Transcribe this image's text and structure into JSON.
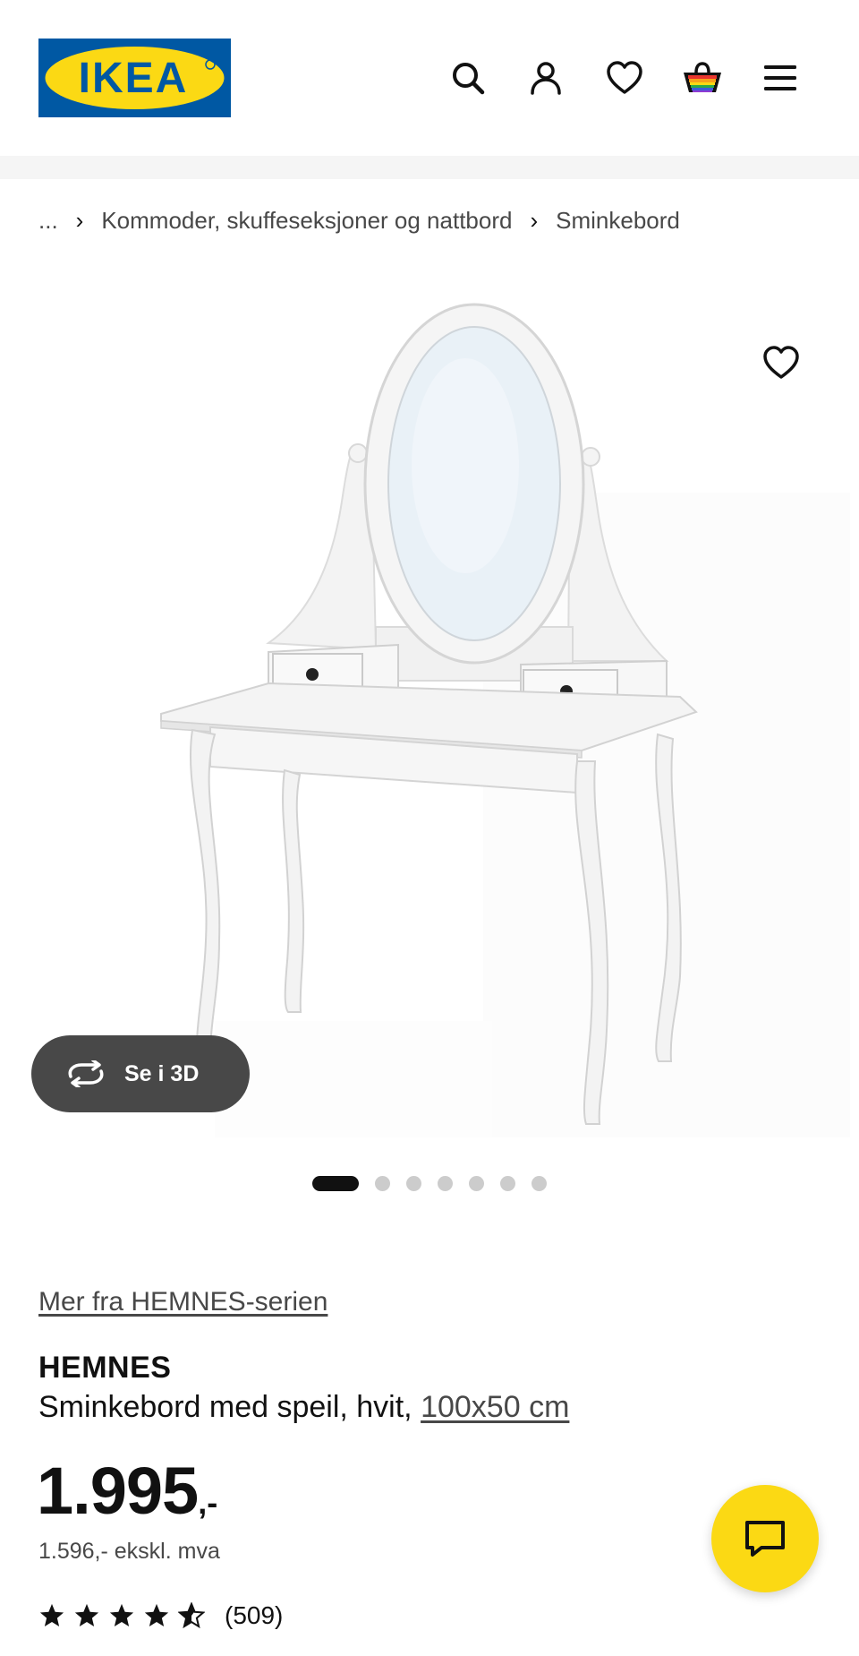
{
  "brand": {
    "logo_text": "IKEA",
    "colors": {
      "blue": "#0058a3",
      "yellow": "#fbd914"
    }
  },
  "header": {
    "icons": [
      "search-icon",
      "user-icon",
      "heart-icon",
      "basket-icon",
      "menu-icon"
    ]
  },
  "breadcrumb": {
    "ellipsis": "...",
    "separator": "›",
    "items": [
      "Kommoder, skuffeseksjoner og nattbord",
      "Sminkebord"
    ]
  },
  "gallery": {
    "button_3d_label": "Se i 3D",
    "total_images": 7,
    "active_index": 0
  },
  "product": {
    "series_link": "Mer fra HEMNES-serien",
    "name": "HEMNES",
    "description": "Sminkebord med speil, hvit, ",
    "size": "100x50 cm",
    "price": "1.995",
    "price_suffix": ",-",
    "price_excl_vat": "1.596,- ekskl. mva",
    "rating": {
      "stars": 4.5,
      "max": 5,
      "count": "(509)"
    }
  },
  "chat": {
    "icon": "chat-icon"
  }
}
